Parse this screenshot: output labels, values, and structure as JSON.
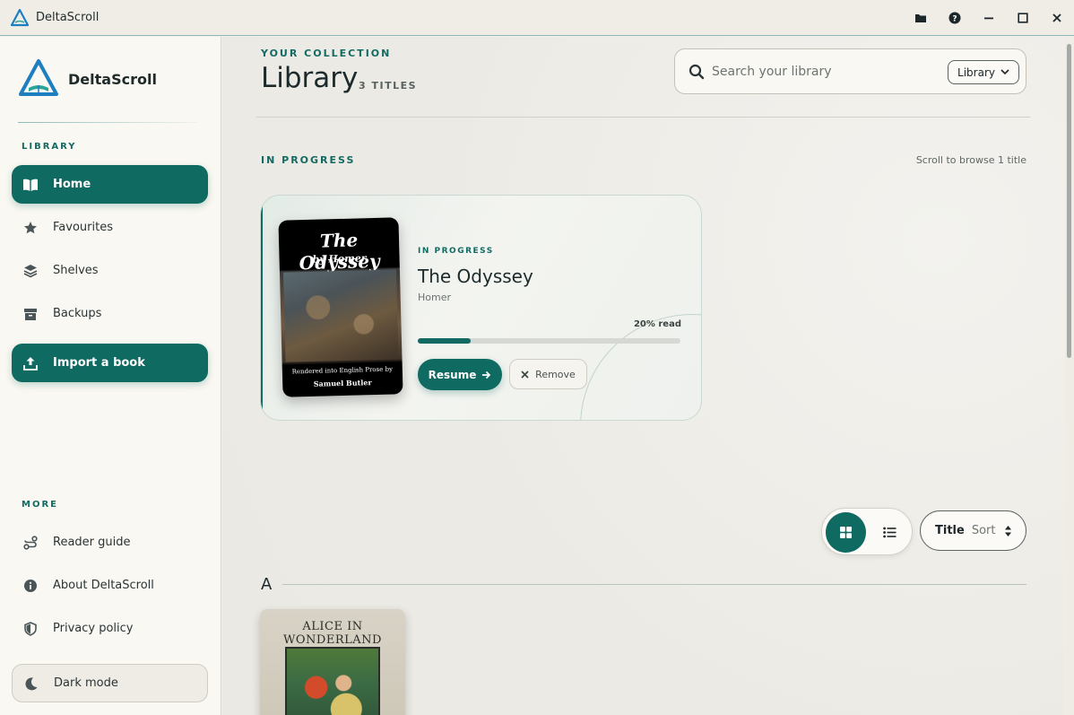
{
  "window": {
    "title": "DeltaScroll",
    "accent": "#0f6a62"
  },
  "titlebar_icons": [
    "folder-icon",
    "help-icon",
    "minimize-icon",
    "maximize-icon",
    "close-icon"
  ],
  "sidebar": {
    "brand": "DeltaScroll",
    "library_label": "LIBRARY",
    "items": [
      {
        "label": "Home",
        "icon": "book-open-icon",
        "active": true
      },
      {
        "label": "Favourites",
        "icon": "star-icon"
      },
      {
        "label": "Shelves",
        "icon": "layers-icon"
      },
      {
        "label": "Backups",
        "icon": "archive-icon"
      }
    ],
    "import_label": "Import a book",
    "more_label": "MORE",
    "more_items": [
      {
        "label": "Reader guide",
        "icon": "route-icon"
      },
      {
        "label": "About DeltaScroll",
        "icon": "info-icon"
      },
      {
        "label": "Privacy policy",
        "icon": "shield-icon"
      }
    ],
    "dark_mode_label": "Dark mode"
  },
  "header": {
    "eyebrow": "YOUR COLLECTION",
    "title": "Library",
    "count": "3 TITLES",
    "search_placeholder": "Search your library",
    "scope": "Library"
  },
  "in_progress": {
    "label": "IN PROGRESS",
    "hint": "Scroll to browse 1 title",
    "book": {
      "status": "IN PROGRESS",
      "title": "The Odyssey",
      "author": "Homer",
      "progress_text": "20% read",
      "progress": 0.2,
      "cover_title": "The Odyssey",
      "cover_author": "by Homer",
      "cover_foot1": "Rendered into English Prose by",
      "cover_foot2": "Samuel Butler",
      "resume_label": "Resume",
      "remove_label": "Remove"
    }
  },
  "listing": {
    "sort_field": "Title",
    "sort_label": "Sort",
    "letter": "A",
    "books": [
      {
        "cover_title": "ALICE IN WONDERLAND"
      }
    ]
  }
}
